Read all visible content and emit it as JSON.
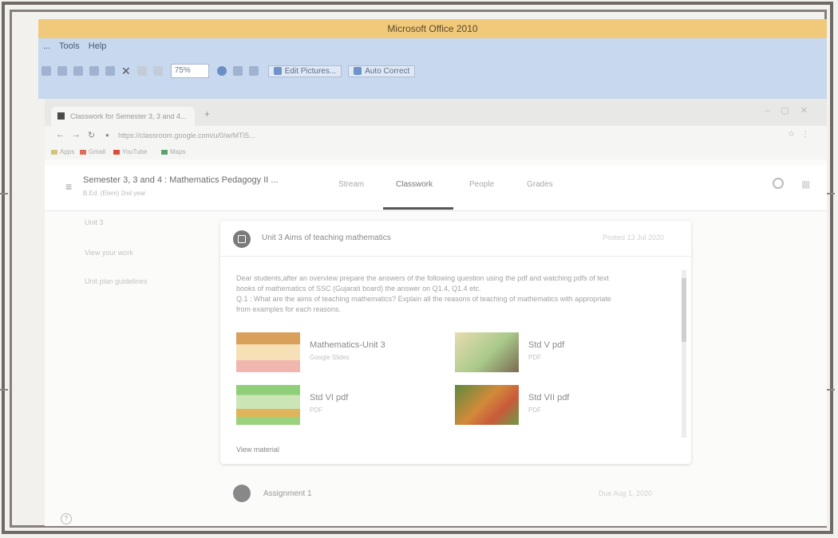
{
  "office": {
    "title": "Microsoft Office 2010",
    "menu": [
      "...",
      "Tools",
      "Help"
    ],
    "zoom": "75%",
    "edit_pictures": "Edit Pictures...",
    "auto_correct": "Auto Correct"
  },
  "browser": {
    "tab_title": "Classwork for Semester 3, 3 and 4...",
    "url": "https://classroom.google.com/u/0/w/MTI5...",
    "bookmarks": [
      "Apps",
      "Gmail",
      "YouTube",
      "Maps"
    ]
  },
  "classroom": {
    "course_title": "Semester 3, 3 and 4 : Mathematics Pedagogy II ...",
    "course_sub": "B.Ed. (Elem) 2nd year",
    "tabs": [
      "Stream",
      "Classwork",
      "People",
      "Grades"
    ],
    "topics": [
      "Unit 3",
      "View your work",
      "Unit plan guidelines"
    ]
  },
  "card": {
    "title": "Unit 3 Aims of teaching mathematics",
    "posted": "Posted 13 Jul 2020",
    "body": [
      "Dear students,after an overview prepare the answers of the following question using the pdf and watching pdfs of text",
      "books of mathematics of SSC (Gujarati board) the answer on Q1.4, Q1.4 etc.",
      "Q.1 : What are the aims of teaching mathematics? Explain all the reasons of teaching of mathematics with appropriate",
      "from examples for each reasons."
    ],
    "attachments": [
      {
        "name": "Mathematics-Unit 3",
        "type": "Google Slides"
      },
      {
        "name": "Std V pdf",
        "type": "PDF"
      },
      {
        "name": "Std VI pdf",
        "type": "PDF"
      },
      {
        "name": "Std VII pdf",
        "type": "PDF"
      }
    ],
    "view_material": "View material"
  },
  "assignment": {
    "title": "Assignment 1",
    "date": "Due Aug 1, 2020"
  },
  "colors": {
    "office_title_bar": "#f0c97b",
    "ribbon": "#c7d8ef",
    "frame": "#6f6a64"
  }
}
